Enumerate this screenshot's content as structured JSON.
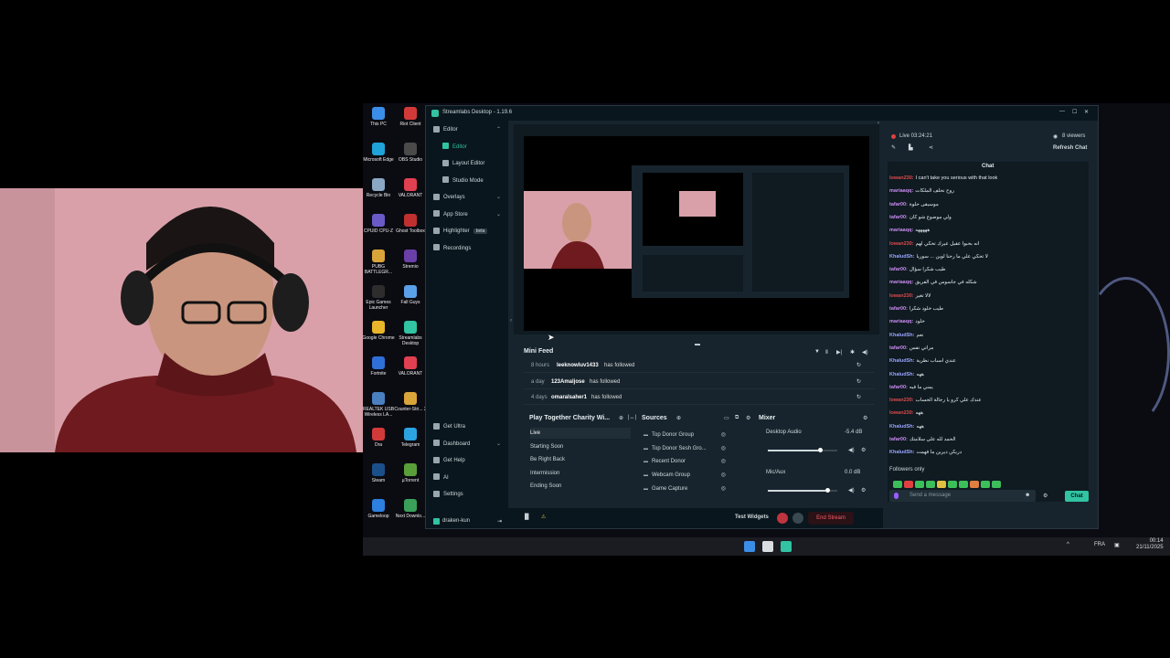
{
  "desktop": {
    "icons_left": [
      {
        "label": "This PC",
        "color": "#3b8ee8"
      },
      {
        "label": "Microsoft Edge",
        "color": "#1fa3d8"
      },
      {
        "label": "Recycle Bin",
        "color": "#8aa7c4"
      },
      {
        "label": "CPUID CPU-Z",
        "color": "#6a5ac8"
      },
      {
        "label": "PUBG BATTLEGR...",
        "color": "#d9a43a"
      },
      {
        "label": "Epic Games Launcher",
        "color": "#2d2d2d"
      },
      {
        "label": "Google Chrome",
        "color": "#e8b52b"
      },
      {
        "label": "Fortnite",
        "color": "#2f6fd8"
      },
      {
        "label": "REALTEK USB Wireless LA...",
        "color": "#4a7fc0"
      },
      {
        "label": "Dra",
        "color": "#d23a3a"
      },
      {
        "label": "Steam",
        "color": "#1b4f8a"
      },
      {
        "label": "Gameloop",
        "color": "#2d7fe0"
      }
    ],
    "icons_right": [
      {
        "label": "Riot Client",
        "color": "#d23a3a"
      },
      {
        "label": "OBS Studio",
        "color": "#4a4a4a"
      },
      {
        "label": "VALORANT",
        "color": "#e04050"
      },
      {
        "label": "Ghost Toolbox",
        "color": "#c03030"
      },
      {
        "label": "Stremio",
        "color": "#6b3fa8"
      },
      {
        "label": "Fall Guys",
        "color": "#5aa0e8"
      },
      {
        "label": "Streamlabs Desktop",
        "color": "#31c3a2"
      },
      {
        "label": "VALORANT",
        "color": "#e04050"
      },
      {
        "label": "Counter-Stri... 2",
        "color": "#d9a43a"
      },
      {
        "label": "Telegram",
        "color": "#2aa3e0"
      },
      {
        "label": "µTorrent",
        "color": "#5aa03a"
      },
      {
        "label": "Next Downlo...",
        "color": "#3aa05a"
      }
    ],
    "taskbar": {
      "lang": "FRA",
      "time": "00:14",
      "date": "21/11/2025"
    }
  },
  "app": {
    "title": "Streamlabs Desktop - 1.19.6",
    "nav": [
      {
        "label": "Editor",
        "icon": "editor-icon",
        "active": false,
        "chevron": "^"
      },
      {
        "label": "Editor",
        "icon": "editor-icon",
        "active": true
      },
      {
        "label": "Layout Editor",
        "icon": "layout-icon"
      },
      {
        "label": "Studio Mode",
        "icon": "studio-icon"
      },
      {
        "label": "Overlays",
        "icon": "overlays-icon",
        "chevron": "v"
      },
      {
        "label": "App Store",
        "icon": "store-icon",
        "chevron": "v"
      },
      {
        "label": "Highlighter",
        "icon": "highlighter-icon",
        "badge": "beta"
      },
      {
        "label": "Recordings",
        "icon": "recordings-icon"
      }
    ],
    "nav_bottom": [
      {
        "label": "Get Ultra",
        "icon": "ultra-icon"
      },
      {
        "label": "Dashboard",
        "icon": "dashboard-icon",
        "chevron": "v"
      },
      {
        "label": "Get Help",
        "icon": "help-icon"
      },
      {
        "label": "AI",
        "icon": "ai-icon"
      },
      {
        "label": "Settings",
        "icon": "settings-icon"
      }
    ],
    "account": "draken-kun",
    "mini_feed": {
      "title": "Mini Feed",
      "rows": [
        {
          "time": "8 hours",
          "user": "leeknowluv1433",
          "action": "has followed"
        },
        {
          "time": "a day",
          "user": "123Amaljose",
          "action": "has followed"
        },
        {
          "time": "4 days",
          "user": "omaralsaher1",
          "action": "has followed"
        }
      ]
    },
    "scenes": {
      "title": "Play Together Charity Wi...",
      "items": [
        "Live",
        "Starting Soon",
        "Be Right Back",
        "Intermission",
        "Ending Soon"
      ]
    },
    "sources": {
      "title": "Sources",
      "items": [
        "Top Donor Group",
        "Top Donor Sesh Gro...",
        "Recent Donor",
        "Webcam Group",
        "Game Capture"
      ]
    },
    "mixer": {
      "title": "Mixer",
      "channels": [
        {
          "name": "Desktop Audio",
          "db": "-5.4 dB",
          "level": 0.72
        },
        {
          "name": "Mic/Aux",
          "db": "0.0 dB",
          "level": 0.83
        }
      ]
    },
    "footer": {
      "test_widgets": "Test Widgets",
      "end_stream": "End Stream"
    }
  },
  "chat": {
    "live_label": "Live 03:24:21",
    "viewers": "8 viewers",
    "refresh": "Refresh Chat",
    "tab": "Chat",
    "messages": [
      {
        "user": "lowan230",
        "color": "#e04a4a",
        "text": "I can't take you serious with that look"
      },
      {
        "user": "mariaaqq",
        "color": "#c98cf0",
        "text": "روح نحلف الملكات"
      },
      {
        "user": "tafar00",
        "color": "#c98cf0",
        "text": "موسيقى حلوة"
      },
      {
        "user": "tafar00",
        "color": "#c98cf0",
        "text": "ولي موضوع شو كان"
      },
      {
        "user": "mariaaqq",
        "color": "#c98cf0",
        "text": "هههههه"
      },
      {
        "user": "lowan230",
        "color": "#e04a4a",
        "text": "انه بحبوا عقيل عيرك تحكي لهم"
      },
      {
        "user": "KhaludSh",
        "color": "#9aa6ff",
        "text": "لا تحكي علي ما رحنا لوين ... سوريا"
      },
      {
        "user": "tafar00",
        "color": "#c98cf0",
        "text": "طيب شكرا سؤال"
      },
      {
        "user": "mariaaqq",
        "color": "#c98cf0",
        "text": "شكله في جاسوس في الفريق"
      },
      {
        "user": "lowan230",
        "color": "#e04a4a",
        "text": "لالا تغير"
      },
      {
        "user": "tafar00",
        "color": "#c98cf0",
        "text": "طيب خلود شكرا"
      },
      {
        "user": "mariaaqq",
        "color": "#c98cf0",
        "text": "خلود"
      },
      {
        "user": "KhaludSh",
        "color": "#9aa6ff",
        "text": "نعم"
      },
      {
        "user": "tafar00",
        "color": "#c98cf0",
        "text": "مراتي نفس"
      },
      {
        "user": "KhaludSh",
        "color": "#9aa6ff",
        "text": "عندي اسباب نظرية"
      },
      {
        "user": "KhaludSh",
        "color": "#9aa6ff",
        "text": "ههه"
      },
      {
        "user": "tafar00",
        "color": "#c98cf0",
        "text": "يمني ما فيه"
      },
      {
        "user": "lowan230",
        "color": "#e04a4a",
        "text": "عندك علي كرو يا رجالة الحساب"
      },
      {
        "user": "lowan230",
        "color": "#e04a4a",
        "text": "ههه"
      },
      {
        "user": "KhaludSh",
        "color": "#9aa6ff",
        "text": "ههه"
      },
      {
        "user": "tafar00",
        "color": "#c98cf0",
        "text": "الحمد لله على سلامتك"
      },
      {
        "user": "KhaludSh",
        "color": "#9aa6ff",
        "text": "دريكن ديرين ما فهمت"
      }
    ],
    "followers_only": "Followers only",
    "input_placeholder": "Send a message",
    "send": "Chat"
  }
}
